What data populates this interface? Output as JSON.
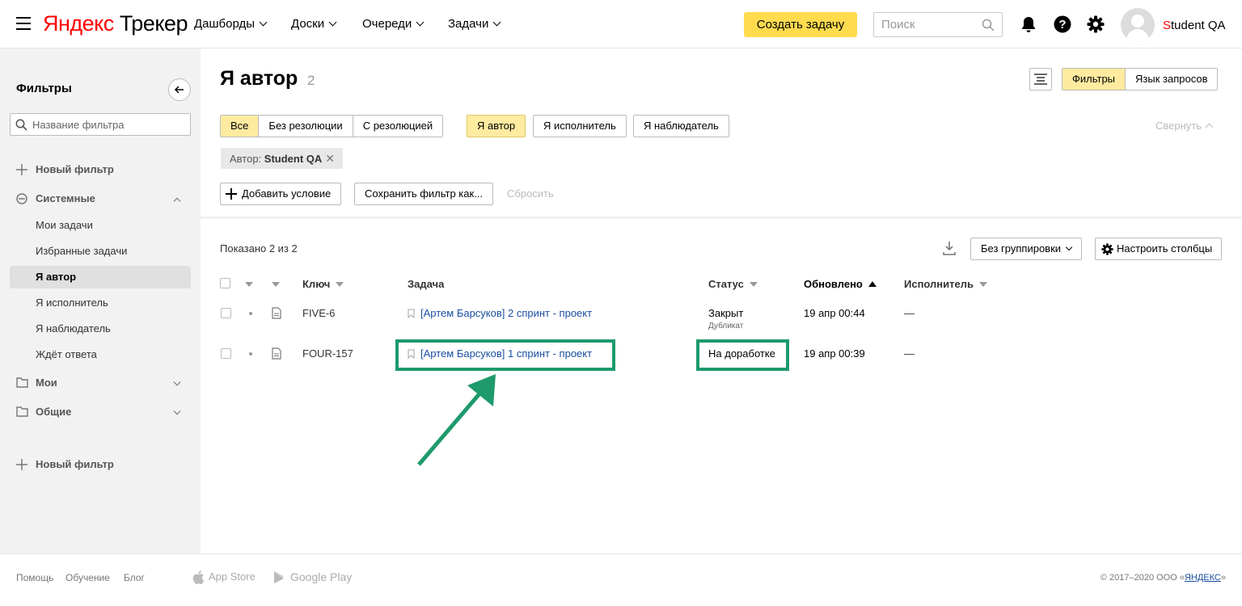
{
  "header": {
    "logo_yandex": "Яндекс",
    "logo_product": "Трекер",
    "nav": [
      "Дашборды",
      "Доски",
      "Очереди",
      "Задачи"
    ],
    "create_button": "Создать задачу",
    "search_placeholder": "Поиск",
    "user_first_letter": "S",
    "user_rest": "tudent QA"
  },
  "sidebar": {
    "title": "Фильтры",
    "search_placeholder": "Название фильтра",
    "new_filter_top": "Новый фильтр",
    "system_group": "Системные",
    "system_items": [
      "Мои задачи",
      "Избранные задачи",
      "Я автор",
      "Я исполнитель",
      "Я наблюдатель",
      "Ждёт ответа"
    ],
    "active_item": "Я автор",
    "my_group": "Мои",
    "common_group": "Общие",
    "new_filter_bottom": "Новый фильтр"
  },
  "main": {
    "title": "Я автор",
    "count": "2",
    "view_toggle": [
      "Фильтры",
      "Язык запросов"
    ],
    "resolution_filters": [
      "Все",
      "Без резолюции",
      "С резолюцией"
    ],
    "role_filters": [
      "Я автор",
      "Я исполнитель",
      "Я наблюдатель"
    ],
    "collapse": "Свернуть",
    "tag_label": "Автор:",
    "tag_value": "Student QA",
    "add_condition": "Добавить условие",
    "save_filter": "Сохранить фильтр как...",
    "reset": "Сбросить",
    "shown_text": "Показано 2 из 2",
    "grouping": "Без группировки",
    "configure_columns": "Настроить столбцы"
  },
  "table": {
    "columns": [
      "Ключ",
      "Задача",
      "Статус",
      "Обновлено",
      "Исполнитель"
    ],
    "rows": [
      {
        "key": "FIVE-6",
        "task": "[Артем Барсуков] 2 спринт - проект",
        "status": "Закрыт",
        "resolution": "Дубликат",
        "updated": "19 апр 00:44",
        "assignee": "—"
      },
      {
        "key": "FOUR-157",
        "task": "[Артем Барсуков] 1 спринт - проект",
        "status": "На доработке",
        "resolution": "",
        "updated": "19 апр 00:39",
        "assignee": "—"
      }
    ]
  },
  "footer": {
    "links": [
      "Помощь",
      "Обучение",
      "Блог"
    ],
    "app_store": "App Store",
    "google_play": "Google Play",
    "copyright_prefix": "© 2017–2020 ООО «",
    "copyright_link": "ЯНДЕКС",
    "copyright_suffix": "»"
  },
  "colors": {
    "accent_yellow": "#ffdb4d",
    "active_filter": "#ffeba0",
    "highlight_green": "#1e9a6c",
    "link_blue": "#1a4fa0"
  }
}
